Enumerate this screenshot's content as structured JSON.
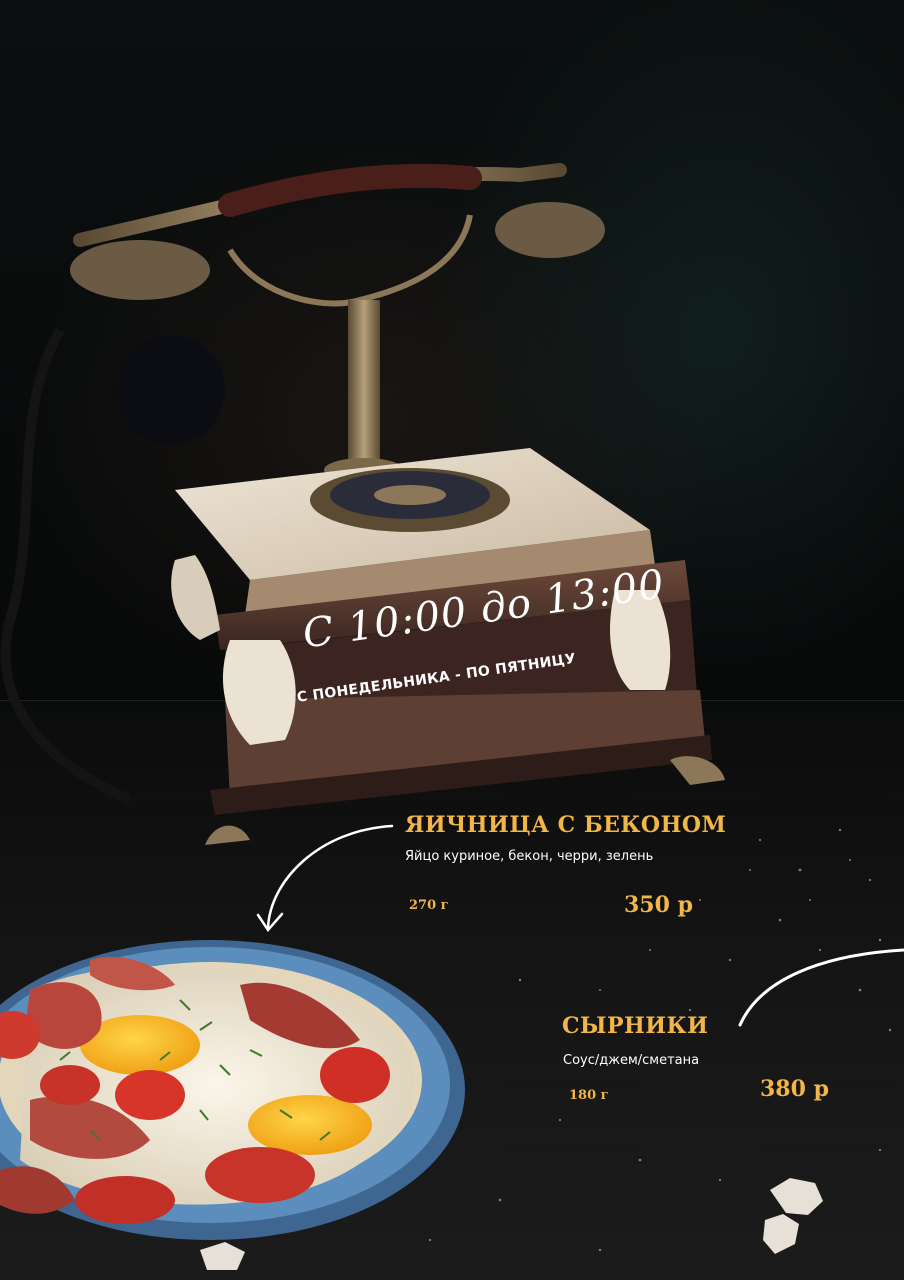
{
  "schedule": {
    "hours": "С 10:00 до 13:00",
    "days": "С ПОНЕДЕЛЬНИКА - ПО ПЯТНИЦУ"
  },
  "menu": {
    "items": [
      {
        "title": "ЯИЧНИЦА С БЕКОНОМ",
        "description": "Яйцо куриное, бекон, черри, зелень",
        "weight": "270 г",
        "price": "350 р"
      },
      {
        "title": "СЫРНИКИ",
        "description": "Соус/джем/сметана",
        "weight": "180 г",
        "price": "380 р"
      }
    ]
  },
  "colors": {
    "accent": "#f2b548",
    "text": "#ffffff",
    "background": "#070707",
    "plate": "#4f7fae"
  },
  "icons": {
    "arrow_1": "curved-arrow-down-icon",
    "arrow_2": "curved-arrow-up-icon"
  }
}
